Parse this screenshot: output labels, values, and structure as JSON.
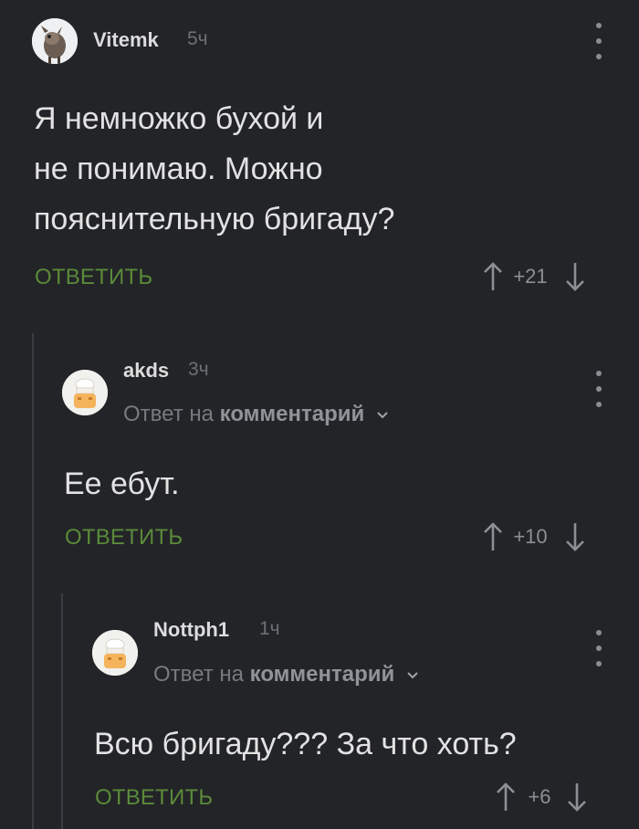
{
  "comments": [
    {
      "username": "Vitemk",
      "time": "5ч",
      "text_lines": [
        "Я немножко бухой и",
        "не понимаю. Можно",
        "пояснительную бригаду?"
      ],
      "reply_label": "ОТВЕТИТЬ",
      "score": "+21"
    },
    {
      "username": "akds",
      "time": "3ч",
      "reply_to_prefix": "Ответ на",
      "reply_to_target": "комментарий",
      "text": "Ее ебут.",
      "reply_label": "ОТВЕТИТЬ",
      "score": "+10"
    },
    {
      "username": "Nottph1",
      "time": "1ч",
      "reply_to_prefix": "Ответ на",
      "reply_to_target": "комментарий",
      "text": "Всю бригаду??? За что хоть?",
      "reply_label": "ОТВЕТИТЬ",
      "score": "+6"
    }
  ],
  "icons": {
    "more": "kebab-menu-icon",
    "upvote": "arrow-up-icon",
    "downvote": "arrow-down-icon",
    "expand": "chevron-down-icon"
  },
  "colors": {
    "background": "#222427",
    "reply_button": "#5b8a3a",
    "thread_line": "#3a3d41"
  }
}
